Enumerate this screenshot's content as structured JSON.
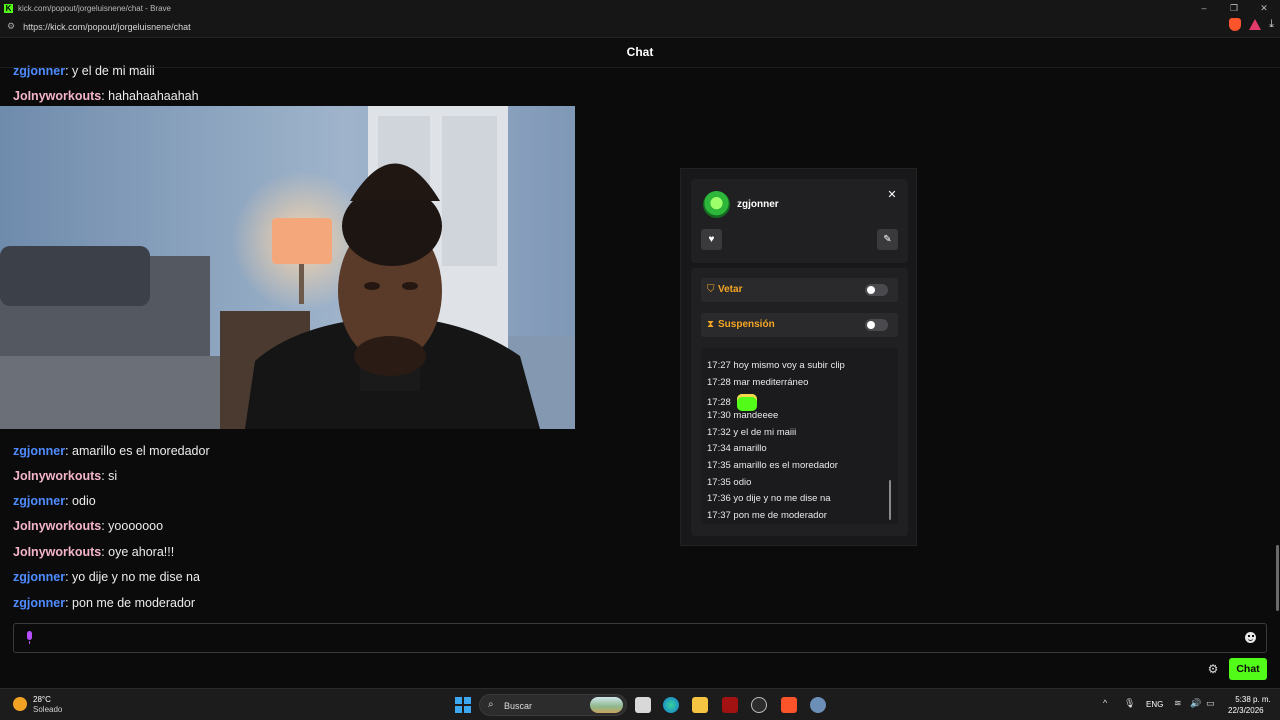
{
  "browser": {
    "window_title": "kick.com/popout/jorgeluisnene/chat - Brave",
    "url": "https://kick.com/popout/jorgeluisnene/chat"
  },
  "chat": {
    "header": "Chat",
    "messages": [
      {
        "user": "zgjonner",
        "sep": ":",
        "text": " y el de mi maiii",
        "color": "#4f8cff"
      },
      {
        "user": "JoInyworkouts",
        "sep": ":",
        "text": " hahahaahaahah",
        "color": "#f5b5c8"
      },
      {
        "user": "zgjonner",
        "sep": ":",
        "text": " amarillo es el moredador",
        "color": "#4f8cff"
      },
      {
        "user": "JoInyworkouts",
        "sep": ":",
        "text": " si",
        "color": "#f5b5c8"
      },
      {
        "user": "zgjonner",
        "sep": ":",
        "text": " odio",
        "color": "#4f8cff"
      },
      {
        "user": "JoInyworkouts",
        "sep": ":",
        "text": " yooooooo",
        "color": "#f5b5c8"
      },
      {
        "user": "JoInyworkouts",
        "sep": ":",
        "text": " oye ahora!!!",
        "color": "#f5b5c8"
      },
      {
        "user": "zgjonner",
        "sep": ":",
        "text": " yo dije y no me dise na",
        "color": "#4f8cff"
      },
      {
        "user": "zgjonner",
        "sep": ":",
        "text": " pon me de moderador",
        "color": "#4f8cff"
      }
    ],
    "send_label": "Chat",
    "accent_color": "#53fc18"
  },
  "popup": {
    "username": "zgjonner",
    "close_label": "✕",
    "ban_label": "Vetar",
    "timeout_label": "Suspensión",
    "history": [
      {
        "time": "17:27",
        "text": "hoy mismo voy a subir clip"
      },
      {
        "time": "17:28",
        "text": "mar mediterráneo"
      },
      {
        "time": "17:28",
        "text": ""
      },
      {
        "time": "17:30",
        "text": "mandeeee"
      },
      {
        "time": "17:32",
        "text": "y el de mi maiii"
      },
      {
        "time": "17:34",
        "text": "amarillo"
      },
      {
        "time": "17:35",
        "text": "amarillo es el moredador"
      },
      {
        "time": "17:35",
        "text": "odio"
      },
      {
        "time": "17:36",
        "text": "yo dije y no me dise na"
      },
      {
        "time": "17:37",
        "text": "pon me de moderador"
      }
    ]
  },
  "taskbar": {
    "weather_temp": "28°C",
    "weather_desc": "Soleado",
    "search_placeholder": "Buscar",
    "lang": "ENG",
    "time": "5:38 p. m.",
    "date": "22/3/2026"
  }
}
